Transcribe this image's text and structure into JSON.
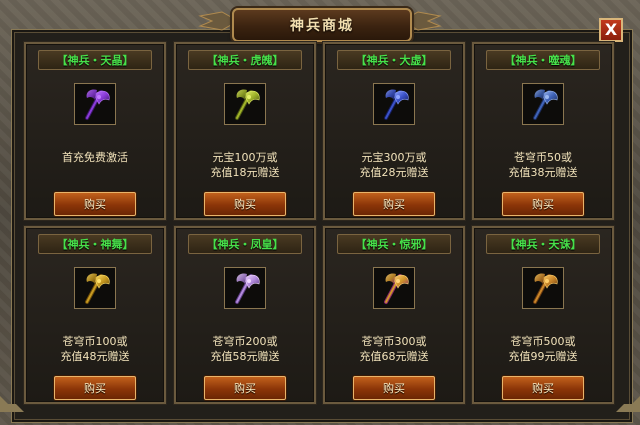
{
  "window": {
    "title": "神兵商城",
    "close_label": "X"
  },
  "cards": [
    {
      "name": "【神兵・天晶】",
      "desc_line1": "首充免费激活",
      "desc_line2": "",
      "buy_label": "购买",
      "colors": [
        "#8a3bd8",
        "#c07bff",
        "#3a1466"
      ]
    },
    {
      "name": "【神兵・虎魄】",
      "desc_line1": "元宝100万或",
      "desc_line2": "充值18元赠送",
      "buy_label": "购买",
      "colors": [
        "#9fb22a",
        "#e4f06a",
        "#4a5510"
      ]
    },
    {
      "name": "【神兵・大虚】",
      "desc_line1": "元宝300万或",
      "desc_line2": "充值28元赠送",
      "buy_label": "购买",
      "colors": [
        "#3b52c8",
        "#8fa4ff",
        "#141c5a"
      ]
    },
    {
      "name": "【神兵・噬魂】",
      "desc_line1": "苍穹币50或",
      "desc_line2": "充值38元赠送",
      "buy_label": "购买",
      "colors": [
        "#3f63b8",
        "#9cb8f0",
        "#1a2a5a"
      ]
    },
    {
      "name": "【神兵・神舞】",
      "desc_line1": "苍穹币100或",
      "desc_line2": "充值48元赠送",
      "buy_label": "购买",
      "colors": [
        "#c79a22",
        "#ffe06a",
        "#6a4a08"
      ]
    },
    {
      "name": "【神兵・凤皇】",
      "desc_line1": "苍穹币200或",
      "desc_line2": "充值58元赠送",
      "buy_label": "购买",
      "colors": [
        "#b28adc",
        "#f0d8ff",
        "#5a3a80"
      ]
    },
    {
      "name": "【神兵・惊邪】",
      "desc_line1": "苍穹币300或",
      "desc_line2": "充值68元赠送",
      "buy_label": "购买",
      "colors": [
        "#d0952a",
        "#ffd27a",
        "#8a2a6a"
      ]
    },
    {
      "name": "【神兵・天诛】",
      "desc_line1": "苍穹币500或",
      "desc_line2": "充值99元赠送",
      "buy_label": "购买",
      "colors": [
        "#c9862a",
        "#ffcf6a",
        "#6a3a10"
      ]
    }
  ]
}
